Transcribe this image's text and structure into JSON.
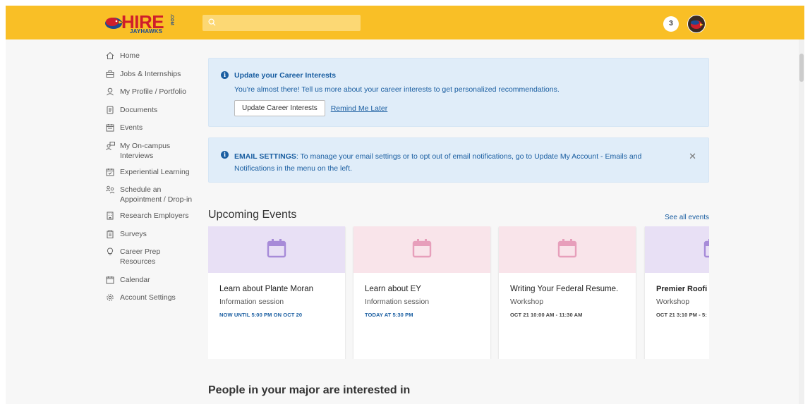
{
  "header": {
    "logo_main": "HIRE",
    "logo_sub": "JAYHAWKS",
    "logo_suffix": ".COM",
    "notification_count": "3"
  },
  "sidebar": {
    "items": [
      {
        "label": "Home",
        "icon": "home-icon"
      },
      {
        "label": "Jobs & Internships",
        "icon": "briefcase-icon"
      },
      {
        "label": "My Profile / Portfolio",
        "icon": "person-icon"
      },
      {
        "label": "Documents",
        "icon": "document-icon"
      },
      {
        "label": "Events",
        "icon": "calendar-icon"
      },
      {
        "label": "My On-campus Interviews",
        "icon": "interview-icon"
      },
      {
        "label": "Experiential Learning",
        "icon": "calendar-check-icon"
      },
      {
        "label": "Schedule an Appointment / Drop-in",
        "icon": "people-icon"
      },
      {
        "label": "Research Employers",
        "icon": "building-icon"
      },
      {
        "label": "Surveys",
        "icon": "clipboard-icon"
      },
      {
        "label": "Career Prep Resources",
        "icon": "lightbulb-icon"
      },
      {
        "label": "Calendar",
        "icon": "calendar-icon"
      },
      {
        "label": "Account Settings",
        "icon": "gear-icon"
      }
    ]
  },
  "alerts": {
    "career": {
      "title": "Update your Career Interests",
      "text": "You're almost there! Tell us more about your career interests to get personalized recommendations.",
      "button": "Update Career Interests",
      "link": "Remind Me Later"
    },
    "email": {
      "strong": "EMAIL SETTINGS",
      "text": ":  To manage your email settings or to opt out of email notifications, go to Update My Account - Emails and Notifications in the menu on the left."
    }
  },
  "events": {
    "title": "Upcoming Events",
    "see_all": "See all events",
    "cards": [
      {
        "title": "Learn about Plante Moran",
        "type": "Information session",
        "when": "NOW UNTIL 5:00 PM ON OCT 20",
        "banner": "#e8e0f5",
        "icon_color": "#a78bd8",
        "when_color": "#1a5ea1"
      },
      {
        "title": "Learn about EY",
        "type": "Information session",
        "when": "TODAY AT 5:30 PM",
        "banner": "#f9e4ea",
        "icon_color": "#e79fbb",
        "when_color": "#1a5ea1"
      },
      {
        "title": "Writing Your Federal Resume.",
        "type": "Workshop",
        "when": "OCT 21 10:00 AM - 11:30 AM",
        "banner": "#f9e4ea",
        "icon_color": "#e79fbb",
        "when_color": "#444"
      },
      {
        "title": "Premier Roofi Career Fair Oc",
        "type": "Workshop",
        "when": "OCT 21 3:10 PM - 5:",
        "banner": "#e8e0f5",
        "icon_color": "#a78bd8",
        "when_color": "#444"
      }
    ]
  },
  "people": {
    "title": "People in your major are interested in"
  }
}
